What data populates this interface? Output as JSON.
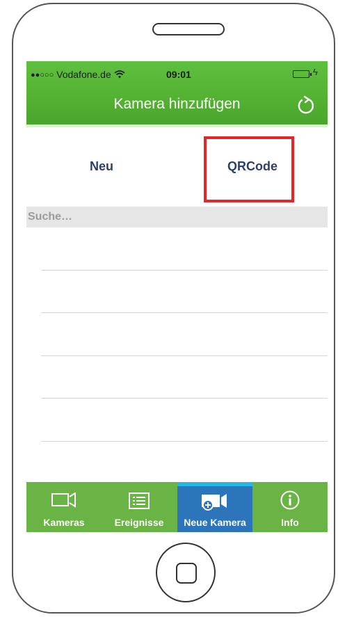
{
  "status_bar": {
    "signal": "●●○○○",
    "carrier": "Vodafone.de",
    "wifi_icon": "wifi-icon",
    "time": "09:01",
    "battery_icon": "battery-icon"
  },
  "header": {
    "title": "Kamera hinzufügen",
    "refresh_icon": "refresh-icon"
  },
  "segments": [
    {
      "label": "Neu"
    },
    {
      "label": "QRCode"
    }
  ],
  "search": {
    "placeholder": "Suche…"
  },
  "list": {
    "rows": 5
  },
  "tabbar": {
    "active": "Neue Kamera",
    "items": [
      {
        "label": "Kameras",
        "icon": "video-camera-icon"
      },
      {
        "label": "Ereignisse",
        "icon": "list-icon"
      },
      {
        "label": "Neue Kamera",
        "icon": "add-camera-icon"
      },
      {
        "label": "Info",
        "icon": "info-icon"
      }
    ]
  },
  "colors": {
    "header_green": "#54b233",
    "tabbar_green": "#6ab446",
    "active_tab_blue": "#2c75bb",
    "active_indicator": "#27b5e6",
    "highlight_red": "#e2262a",
    "segment_text": "#2d3f6b"
  }
}
